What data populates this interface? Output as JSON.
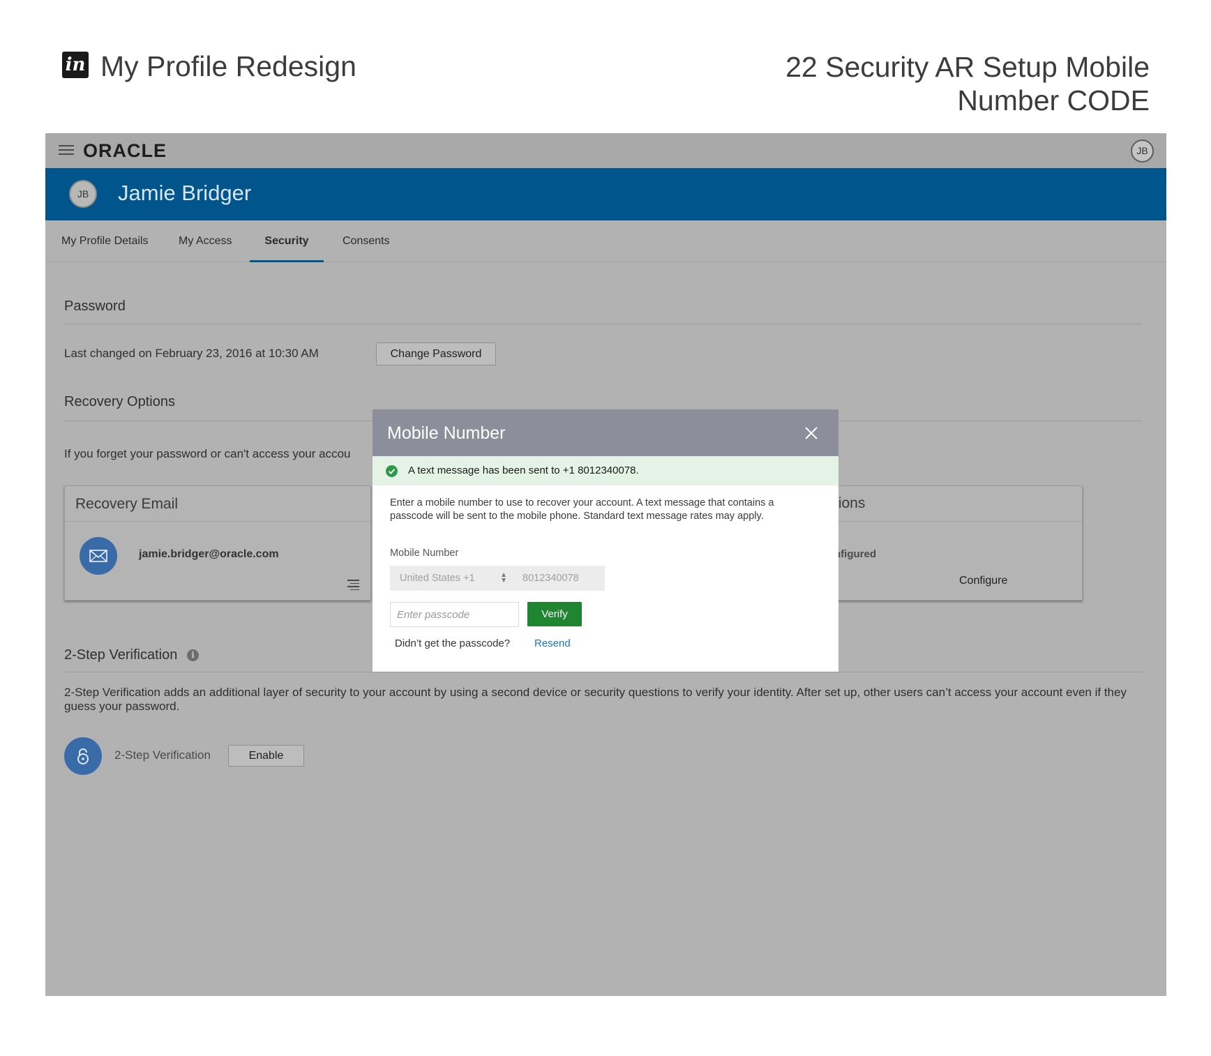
{
  "presentation": {
    "logo_text": "in",
    "project_title": "My Profile Redesign",
    "screen_title_line1": "22 Security AR Setup Mobile",
    "screen_title_line2": "Number CODE"
  },
  "topbar": {
    "brand": "ORACLE",
    "avatar_initials": "JB"
  },
  "banner": {
    "avatar_initials": "JB",
    "user_name": "Jamie Bridger"
  },
  "tabs": [
    {
      "label": "My Profile Details"
    },
    {
      "label": "My Access"
    },
    {
      "label": "Security"
    },
    {
      "label": "Consents"
    }
  ],
  "password": {
    "title": "Password",
    "last_changed": "Last changed on February 23, 2016 at 10:30 AM",
    "change_button": "Change Password"
  },
  "recovery": {
    "title": "Recovery Options",
    "description_visible": "If you forget your password or can't access your accou",
    "email_card": {
      "title": "Recovery Email",
      "email": "jamie.bridger@oracle.com"
    },
    "questions_card": {
      "title_fragment": "tions",
      "status_fragment": "nfigured",
      "configure_label": "Configure"
    }
  },
  "two_step": {
    "title": "2-Step Verification",
    "description": "2-Step Verification adds an additional layer of security to your account by using a second device or security questions to verify your identity. After set up, other users can’t access your account even if they guess your password.",
    "row_label": "2-Step Verification",
    "enable_button": "Enable"
  },
  "modal": {
    "title": "Mobile Number",
    "alert_text": "A text message has been sent to +1 8012340078.",
    "description": "Enter a mobile number to use to recover your account.  A text message that contains a passcode will be sent to the mobile phone. Standard text message rates may apply.",
    "field_label": "Mobile Number",
    "country_value": "United States +1",
    "phone_value": "8012340078",
    "passcode_placeholder": "Enter passcode",
    "verify_label": "Verify",
    "resend_prompt": "Didn’t get the passcode?",
    "resend_label": "Resend"
  },
  "colors": {
    "banner": "#00558c",
    "verify_button": "#1f8530",
    "alert_bg": "#e4f3e6",
    "link": "#1677c7",
    "modal_header": "#8c8f9b"
  }
}
